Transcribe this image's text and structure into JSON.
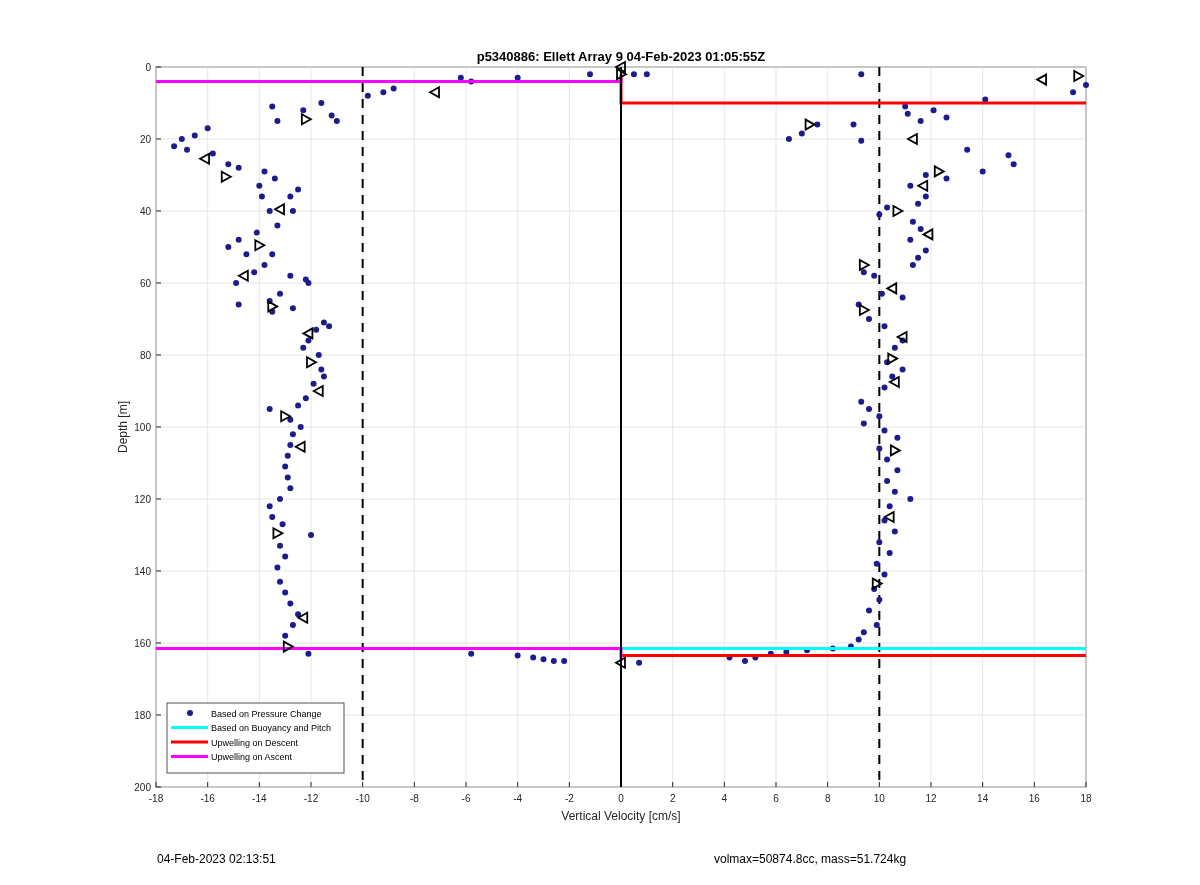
{
  "figure": {
    "chart_data": {
      "type": "scatter",
      "title": "p5340886: Ellett Array 9 04-Feb-2023 01:05:55Z",
      "xlabel": "Vertical Velocity [cm/s]",
      "ylabel": "Depth [m]",
      "xlim": [
        -18,
        18
      ],
      "ylim": [
        200,
        0
      ],
      "xticks": [
        -18,
        -16,
        -14,
        -12,
        -10,
        -8,
        -6,
        -4,
        -2,
        0,
        2,
        4,
        6,
        8,
        10,
        12,
        14,
        16,
        18
      ],
      "yticks": [
        0,
        20,
        40,
        60,
        80,
        100,
        120,
        140,
        160,
        180,
        200
      ],
      "series": [
        {
          "name": "Based on Pressure Change",
          "color": "#1c1c8c",
          "type": "scatter",
          "marker": "circle",
          "x": [
            -13.5,
            -13.3,
            -12.3,
            -11.6,
            -11.2,
            -11,
            -16,
            -16.5,
            -17,
            -17.3,
            -16.8,
            -15.8,
            -15.2,
            -14.8,
            -13.8,
            -13.4,
            -14,
            -13.9,
            -12.5,
            -12.8,
            -13.6,
            -12.7,
            -13.3,
            -14.1,
            -14.8,
            -15.2,
            -14.5,
            -13.5,
            -13.8,
            -14.2,
            -14.9,
            -14.8,
            -12.8,
            -12.2,
            -12.1,
            -13.2,
            -13.6,
            -13.5,
            -12.7,
            -11.5,
            -11.8,
            -11.3,
            -12.1,
            -12.3,
            -11.7,
            -11.6,
            -11.5,
            -11.9,
            -12.2,
            -12.5,
            -13.6,
            -12.8,
            -12.4,
            -12.7,
            -12.8,
            -12.9,
            -13,
            -12.9,
            -12.8,
            -13.2,
            -13.6,
            -13.5,
            -13.1,
            -12,
            -13.2,
            -13,
            -13.3,
            -13.2,
            -13,
            -12.8,
            -12.5,
            -12.7,
            -13,
            -12.1,
            -9.8,
            -9.2,
            -8.8,
            -6.2,
            -5.8,
            -4,
            -1.2,
            0.5,
            1,
            9.3,
            17.5,
            18,
            -5.8,
            -4,
            -3.4,
            -3,
            -2.6,
            -2.2,
            0.7,
            4.2,
            4.8,
            5.2,
            5.8,
            6.4,
            7.2,
            8.2,
            6.5,
            7,
            7.6,
            9,
            9.3,
            11,
            11.1,
            11.6,
            12.1,
            12.6,
            13.4,
            14,
            14.1,
            15,
            15.2,
            12.6,
            11.8,
            11.2,
            11.8,
            11.5,
            10.3,
            10,
            11.3,
            11.6,
            11.2,
            11.8,
            11.5,
            11.3,
            9.4,
            9.8,
            10.1,
            10.9,
            9.2,
            9.6,
            10.2,
            10.9,
            10.6,
            10.3,
            10.9,
            10.5,
            10.2,
            9.3,
            9.6,
            10,
            9.4,
            10.2,
            10.7,
            10,
            10.3,
            10.7,
            10.3,
            10.6,
            11.2,
            10.4,
            10.2,
            10.6,
            10,
            10.4,
            9.9,
            10.2,
            9.8,
            10,
            9.6,
            9.9,
            9.4,
            9.2,
            8.9
          ],
          "values": [
            11,
            15,
            12,
            10,
            13.5,
            15,
            17,
            19,
            20,
            22,
            23,
            24,
            27,
            28,
            29,
            31,
            33,
            36,
            34,
            36,
            40,
            40,
            44,
            46,
            48,
            50,
            52,
            52,
            55,
            57,
            60,
            66,
            58,
            59,
            60,
            63,
            65,
            68,
            67,
            71,
            73,
            72,
            76,
            78,
            80,
            84,
            86,
            88,
            92,
            94,
            95,
            98,
            100,
            102,
            105,
            108,
            111,
            114,
            117,
            120,
            122,
            125,
            127,
            130,
            133,
            136,
            139,
            143,
            146,
            149,
            152,
            155,
            158,
            163,
            8,
            7,
            6,
            3,
            4,
            3,
            2,
            2,
            2,
            2,
            7,
            5,
            163,
            163.5,
            164,
            164.5,
            165,
            165,
            165.5,
            164,
            165,
            164,
            163,
            162.5,
            162,
            161.5,
            20,
            18.5,
            16,
            16,
            20.5,
            11,
            13,
            15,
            12,
            14,
            23,
            29,
            9,
            24.5,
            27,
            31,
            30,
            33,
            36,
            38,
            39,
            41,
            43,
            45,
            48,
            51,
            53,
            55,
            57,
            58,
            63,
            64,
            66,
            70,
            72,
            76,
            78,
            82,
            84,
            86,
            89,
            93,
            95,
            97,
            99,
            101,
            103,
            106,
            109,
            112,
            115,
            118,
            120,
            122,
            126,
            129,
            132,
            135,
            138,
            141,
            145,
            148,
            151,
            155,
            157,
            159,
            161
          ]
        },
        {
          "name": "Based on Buoyancy and Pitch",
          "color": "#00ffff",
          "type": "line",
          "x": [
            0,
            18
          ],
          "values": [
            161.5,
            161.5
          ]
        },
        {
          "name": "Upwelling on Descent",
          "color": "#ff0000",
          "type": "line",
          "x": [
            0,
            0,
            18,
            null,
            0,
            18
          ],
          "values": [
            2,
            10,
            10,
            null,
            163.5,
            163.5
          ]
        },
        {
          "name": "Upwelling on Ascent",
          "color": "#ff00ff",
          "type": "line",
          "x": [
            -18,
            0,
            0,
            null,
            -18,
            0,
            0
          ],
          "values": [
            4,
            4,
            3,
            null,
            161.5,
            161.5,
            165
          ]
        },
        {
          "color": "#000000",
          "type": "line",
          "x": [
            0,
            0
          ],
          "values": [
            0,
            200
          ]
        },
        {
          "color": "#000000",
          "type": "scatter",
          "marker": "triangle",
          "x": [
            0,
            0,
            -7.2,
            -12.2,
            -16.1,
            -15.3,
            -13.2,
            -14,
            -14.6,
            -13.5,
            -12.1,
            -12,
            -11.7,
            -13,
            -12.4,
            -13.3,
            -12.3,
            -12.9,
            0,
            7.3,
            11.3,
            12.3,
            11.7,
            10.7,
            11.9,
            9.4,
            10.5,
            9.4,
            10.9,
            10.5,
            10.6,
            10.6,
            10.4,
            9.9,
            16.3,
            17.7
          ],
          "values": [
            0,
            2,
            7,
            14.5,
            25.5,
            30.5,
            39.5,
            49.5,
            58,
            66.5,
            74,
            82,
            90,
            97,
            105.5,
            129.5,
            153,
            161,
            165.5,
            16,
            20,
            29,
            33,
            40,
            46.5,
            55,
            61.5,
            67.5,
            75,
            81,
            87.5,
            106.5,
            125,
            143.5,
            3.5,
            2.5
          ]
        }
      ],
      "ref_lines": [
        {
          "axis": "x",
          "value": -10
        },
        {
          "axis": "x",
          "value": 10
        }
      ],
      "grid": true,
      "legend": "lower left"
    }
  },
  "footer": {
    "printed_at": "04-Feb-2023 02:13:51",
    "parameters": "volmax=50874.8cc, mass=51.724kg"
  }
}
